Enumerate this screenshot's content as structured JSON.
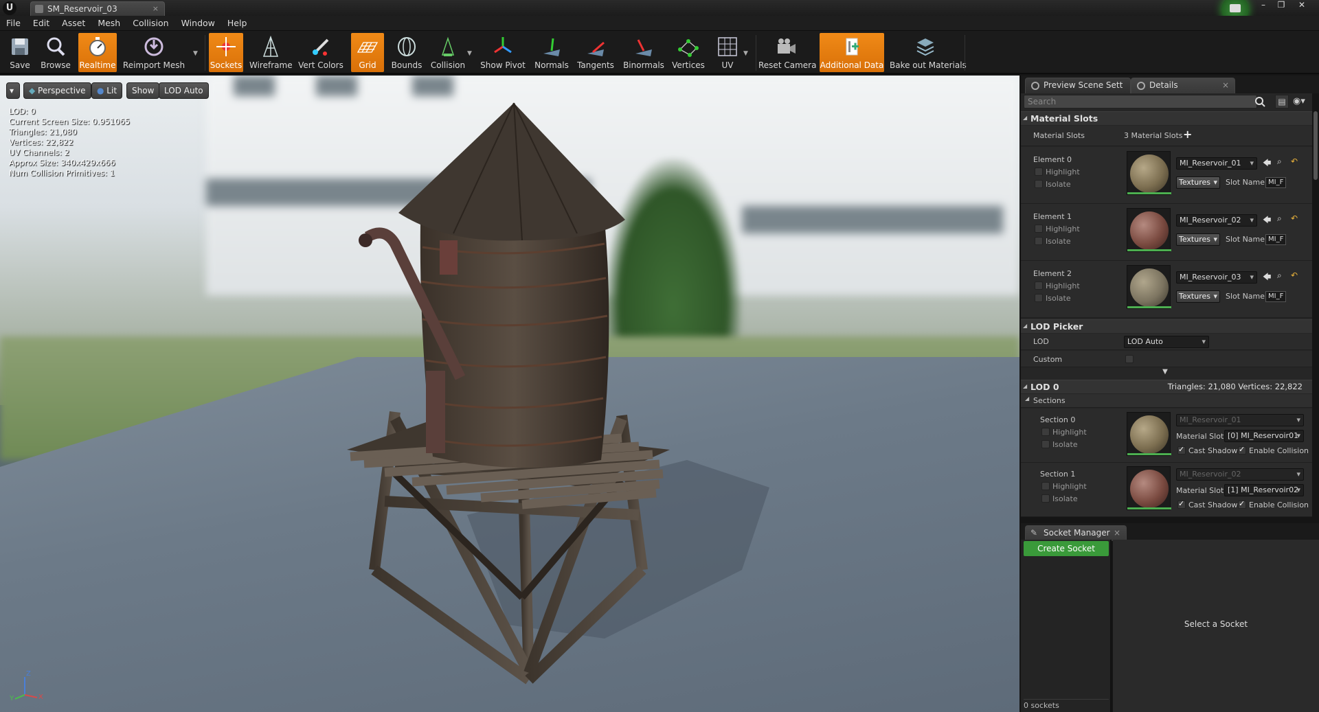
{
  "window": {
    "tab_title": "SM_Reservoir_03",
    "tab_close": "×",
    "controls": [
      "–",
      "❐",
      "✕"
    ]
  },
  "menu": [
    "File",
    "Edit",
    "Asset",
    "Mesh",
    "Collision",
    "Window",
    "Help"
  ],
  "toolbar": {
    "buttons": [
      {
        "label": "Save",
        "icon": "save-icon",
        "active": false
      },
      {
        "label": "Browse",
        "icon": "browse-icon",
        "active": false
      },
      {
        "label": "Realtime",
        "icon": "realtime-icon",
        "active": true
      },
      {
        "label": "Reimport Mesh",
        "icon": "reimport-icon",
        "active": false
      },
      {
        "label": "Sockets",
        "icon": "sockets-icon",
        "active": true
      },
      {
        "label": "Wireframe",
        "icon": "wireframe-icon",
        "active": false
      },
      {
        "label": "Vert Colors",
        "icon": "vert-colors-icon",
        "active": false
      },
      {
        "label": "Grid",
        "icon": "grid-icon",
        "active": true
      },
      {
        "label": "Bounds",
        "icon": "bounds-icon",
        "active": false
      },
      {
        "label": "Collision",
        "icon": "collision-icon",
        "active": false
      },
      {
        "label": "Show Pivot",
        "icon": "pivot-icon",
        "active": false
      },
      {
        "label": "Normals",
        "icon": "normals-icon",
        "active": false
      },
      {
        "label": "Tangents",
        "icon": "tangents-icon",
        "active": false
      },
      {
        "label": "Binormals",
        "icon": "binormals-icon",
        "active": false
      },
      {
        "label": "Vertices",
        "icon": "vertices-icon",
        "active": false
      },
      {
        "label": "UV",
        "icon": "uv-icon",
        "active": false
      },
      {
        "label": "Reset Camera",
        "icon": "camera-icon",
        "active": false
      },
      {
        "label": "Additional Data",
        "icon": "additional-data-icon",
        "active": true
      },
      {
        "label": "Bake out Materials",
        "icon": "bake-materials-icon",
        "active": false
      }
    ]
  },
  "viewport": {
    "buttons": {
      "perspective": "Perspective",
      "lit": "Lit",
      "show": "Show",
      "lod": "LOD Auto"
    },
    "stats": [
      "LOD:  0",
      "Current Screen Size:  0.951065",
      "Triangles:  21,080",
      "Vertices:  22,822",
      "UV Channels:  2",
      "Approx Size: 340x429x666",
      "Num Collision Primitives:  1"
    ],
    "axis": {
      "z": "Z",
      "y": "Y",
      "x": "X"
    }
  },
  "panel_tabs": {
    "preview": "Preview Scene Sett",
    "details": "Details",
    "close": "×"
  },
  "details": {
    "search_placeholder": "Search",
    "material_slots": {
      "header": "Material Slots",
      "label": "Material Slots",
      "count": "3 Material Slots",
      "add": "+",
      "elements": [
        {
          "name": "Element 0",
          "material": "MI_Reservoir_01",
          "textures": "Textures",
          "slot_name_label": "Slot Name",
          "slot_name": "MI_F",
          "color": "#8a7a5a"
        },
        {
          "name": "Element 1",
          "material": "MI_Reservoir_02",
          "textures": "Textures",
          "slot_name_label": "Slot Name",
          "slot_name": "MI_F",
          "color": "#7a4a40"
        },
        {
          "name": "Element 2",
          "material": "MI_Reservoir_03",
          "textures": "Textures",
          "slot_name_label": "Slot Name",
          "slot_name": "MI_F",
          "color": "#7c7460"
        }
      ],
      "highlight": "Highlight",
      "isolate": "Isolate"
    },
    "lod_picker": {
      "header": "LOD Picker",
      "lod_label": "LOD",
      "lod_value": "LOD Auto",
      "custom_label": "Custom"
    },
    "lod0": {
      "header": "LOD 0",
      "stats": "Triangles: 21,080    Vertices: 22,822",
      "sections_label": "Sections",
      "sections": [
        {
          "name": "Section 0",
          "material": "MI_Reservoir_01",
          "slot_label": "Material Slot",
          "slot_value": "[0] MI_Reservoir01",
          "cast_shadow": "Cast Shadow",
          "enable_collision": "Enable Collision",
          "color": "#8a7a5a"
        },
        {
          "name": "Section 1",
          "material": "MI_Reservoir_02",
          "slot_label": "Material Slot",
          "slot_value": "[1] MI_Reservoir02",
          "cast_shadow": "Cast Shadow",
          "enable_collision": "Enable Collision",
          "color": "#7a4a40"
        }
      ]
    }
  },
  "socket_manager": {
    "tab": "Socket Manager",
    "create": "Create Socket",
    "count": "0 sockets",
    "empty": "Select a Socket"
  }
}
